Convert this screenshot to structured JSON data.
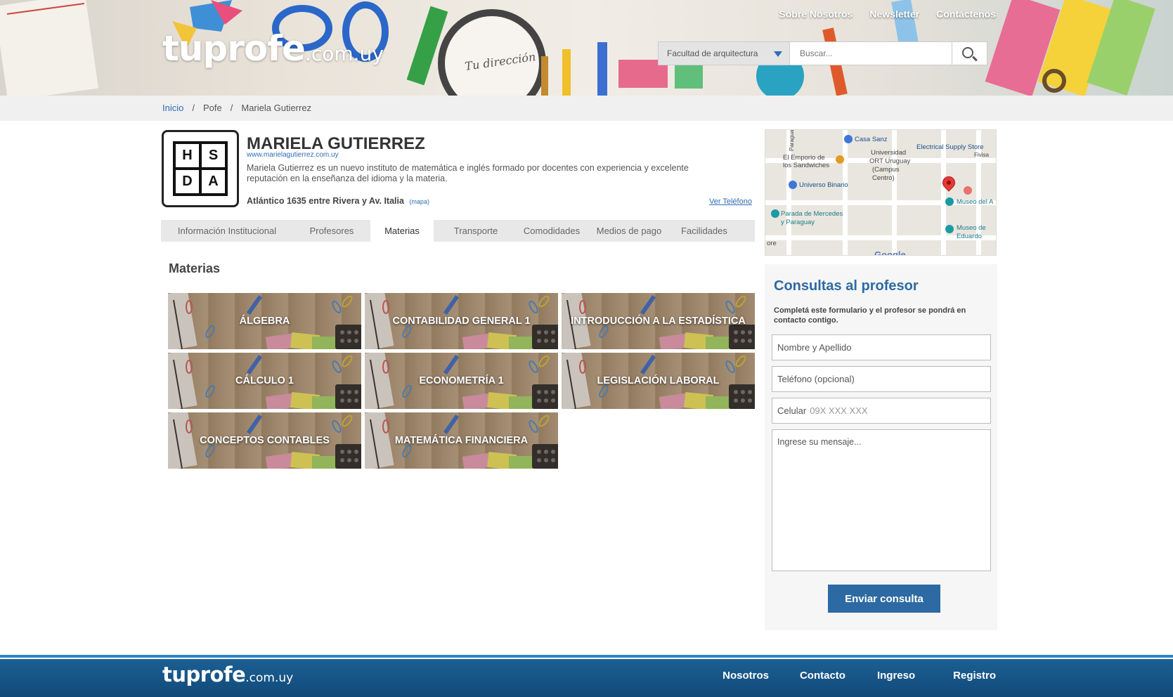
{
  "header": {
    "logo_brand": "tuprofe",
    "logo_tld": ".com.uy",
    "nav": [
      "Sobre Nosotros",
      "Newsletter",
      "Contáctenos"
    ],
    "banner_text": "Tu dirección",
    "search": {
      "select_value": "Facultad de arquitectura",
      "placeholder": "Buscar..."
    }
  },
  "breadcrumb": [
    "Inicio",
    "Pofe",
    "Mariela Gutierrez"
  ],
  "profile": {
    "logo_letters": [
      "H",
      "S",
      "D",
      "A"
    ],
    "name": "MARIELA GUTIERREZ",
    "url": "www.marielagutierrez.com.uy",
    "description": "Mariela Gutierrez es un nuevo instituto de matemática e inglés formado por docentes con experiencia y excelente reputación en la enseñanza del idioma y la materia.",
    "address": "Atlántico 1635 entre Rivera y Av. Italia",
    "map_link": "(mapa)",
    "phone_link": "Ver Teléfono"
  },
  "tabs": [
    {
      "label": "Información Institucional",
      "active": false
    },
    {
      "label": "Profesores",
      "active": false
    },
    {
      "label": "Materias",
      "active": true
    },
    {
      "label": "Transporte",
      "active": false
    },
    {
      "label": "Comodidades",
      "active": false
    },
    {
      "label": "Medios de pago",
      "active": false
    },
    {
      "label": "Facilidades",
      "active": false
    }
  ],
  "section_title": "Materias",
  "subjects": [
    "ÁLGEBRA",
    "CONTABILIDAD GENERAL 1",
    "INTRODUCCIÓN A LA ESTADÍSTICA",
    "CÁLCULO 1",
    "ECONOMETRÍA 1",
    "LEGISLACIÓN LABORAL",
    "CONCEPTOS CONTABLES",
    "MATEMÁTICA FINANCIERA"
  ],
  "map": {
    "labels": [
      "Casa Sanz",
      "Electrical Supply Store",
      "Fivisa",
      "El Emporio de",
      "los Sandwiches",
      "Universidad",
      "ORT Uruguay",
      "(Campus",
      "Centro)",
      "Universo Binario",
      "Museo del A",
      "Parada de Mercedes",
      "y Paraguay",
      "Museo de",
      "Eduardo",
      "ore",
      "Paraguay"
    ],
    "attribution": "Google"
  },
  "contact": {
    "title": "Consultas al profesor",
    "intro": "Completá este formulario y el profesor se pondrá en contacto contigo.",
    "name_placeholder": "Nombre y Apellido",
    "phone_placeholder": "Teléfono (opcional)",
    "cell_label": "Celular",
    "cell_placeholder": "09X XXX XXX",
    "message_placeholder": "Ingrese su mensaje...",
    "submit": "Enviar consulta"
  },
  "footer": {
    "logo_brand": "tuprofe",
    "logo_tld": ".com.uy",
    "nav": [
      "Nosotros",
      "Contacto",
      "Ingreso",
      "Registro"
    ]
  },
  "colors": {
    "accent": "#2d6aa3",
    "link": "#2d6db5",
    "footer": "#1c5f93"
  }
}
